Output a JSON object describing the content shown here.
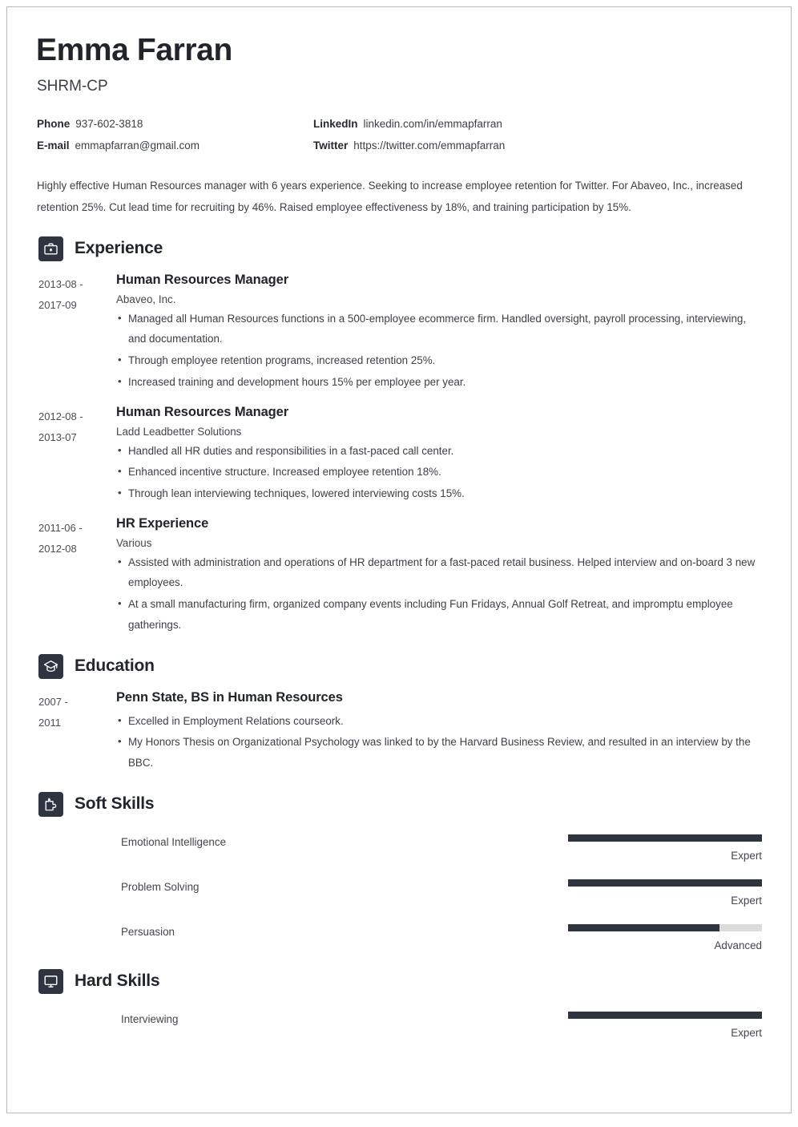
{
  "header": {
    "name": "Emma Farran",
    "subtitle": "SHRM-CP",
    "contacts": [
      {
        "label": "Phone",
        "value": "937-602-3818"
      },
      {
        "label": "LinkedIn",
        "value": "linkedin.com/in/emmapfarran"
      },
      {
        "label": "E-mail",
        "value": "emmapfarran@gmail.com"
      },
      {
        "label": "Twitter",
        "value": "https://twitter.com/emmapfarran"
      }
    ]
  },
  "summary": "Highly effective Human Resources manager with 6 years experience. Seeking to increase employee retention for Twitter. For Abaveo, Inc., increased retention 25%. Cut lead time for recruiting by 46%. Raised employee effectiveness by 18%, and training participation by 15%.",
  "sections": {
    "experience": {
      "title": "Experience",
      "icon": "briefcase-icon",
      "entries": [
        {
          "dates": "2013-08 - 2017-09",
          "title": "Human Resources Manager",
          "org": "Abaveo, Inc.",
          "bullets": [
            "Managed all Human Resources functions in a 500-employee ecommerce firm. Handled oversight, payroll processing, interviewing, and documentation.",
            "Through employee retention programs, increased retention 25%.",
            "Increased training and development hours 15% per employee per year."
          ]
        },
        {
          "dates": "2012-08 - 2013-07",
          "title": "Human Resources Manager",
          "org": "Ladd Leadbetter Solutions",
          "bullets": [
            "Handled all HR duties and responsibilities in a fast-paced call center.",
            "Enhanced incentive structure. Increased employee retention 18%.",
            "Through lean interviewing techniques, lowered interviewing costs 15%."
          ]
        },
        {
          "dates": "2011-06 - 2012-08",
          "title": "HR Experience",
          "org": "Various",
          "bullets": [
            "Assisted with administration and operations of HR department for a fast-paced retail business. Helped interview and on-board 3 new employees.",
            "At a small manufacturing firm, organized company events including Fun Fridays, Annual Golf Retreat, and impromptu employee gatherings."
          ]
        }
      ]
    },
    "education": {
      "title": "Education",
      "icon": "graduation-cap-icon",
      "entries": [
        {
          "dates": "2007 - 2011",
          "title": "Penn State, BS in Human Resources",
          "org": "",
          "bullets": [
            "Excelled in Employment Relations courseork.",
            "My Honors Thesis on Organizational Psychology was linked to by the Harvard Business Review, and resulted in an interview by the BBC."
          ]
        }
      ]
    },
    "soft_skills": {
      "title": "Soft Skills",
      "icon": "puzzle-piece-icon",
      "skills": [
        {
          "name": "Emotional Intelligence",
          "level": "Expert",
          "percent": 100
        },
        {
          "name": "Problem Solving",
          "level": "Expert",
          "percent": 100
        },
        {
          "name": "Persuasion",
          "level": "Advanced",
          "percent": 78
        }
      ]
    },
    "hard_skills": {
      "title": "Hard Skills",
      "icon": "monitor-icon",
      "skills": [
        {
          "name": "Interviewing",
          "level": "Expert",
          "percent": 100
        }
      ]
    }
  },
  "colors": {
    "accent_dark": "#2e3440",
    "bar_track": "#dcdcdc",
    "text": "#3d4047",
    "heading": "#21242b",
    "page_border": "#b9b9b9"
  }
}
